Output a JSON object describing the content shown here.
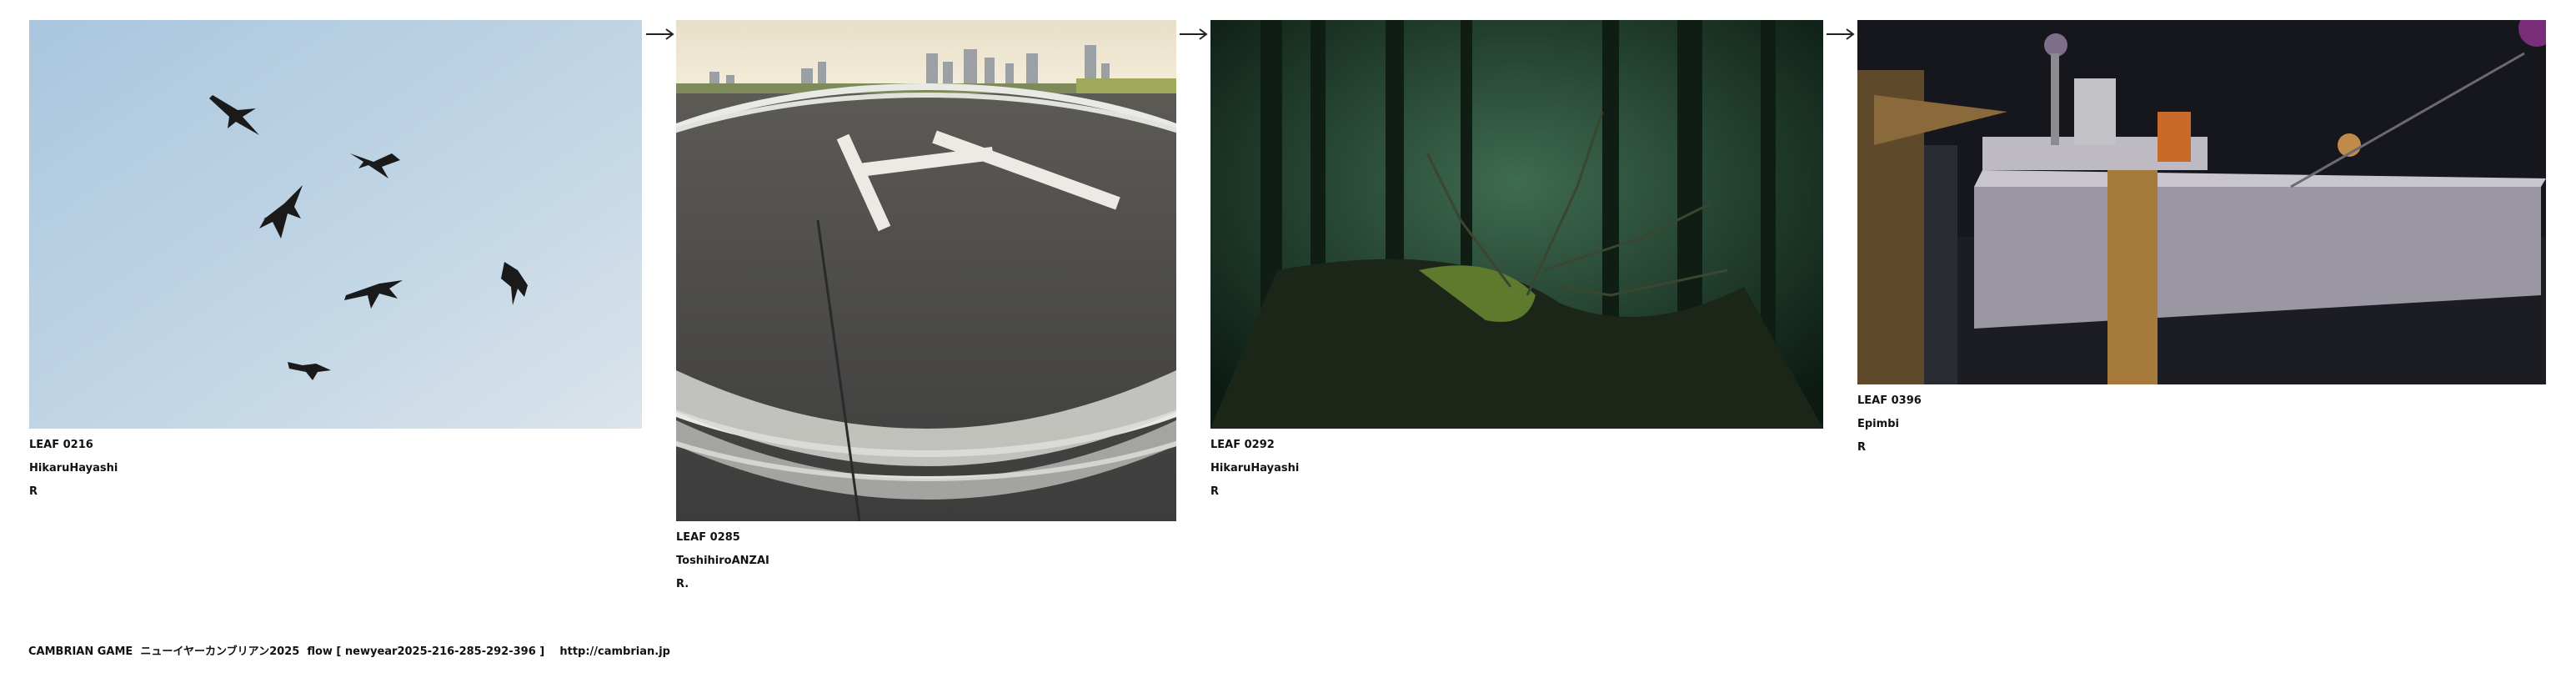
{
  "leaves": [
    {
      "id": "LEAF 0216",
      "author": "HikaruHayashi",
      "mark": "R",
      "image": "birds-in-sky"
    },
    {
      "id": "LEAF 0285",
      "author": "ToshihiroANZAI",
      "mark": "R.",
      "image": "helipad-asphalt"
    },
    {
      "id": "LEAF 0292",
      "author": "HikaruHayashi",
      "mark": "R",
      "image": "dark-forest"
    },
    {
      "id": "LEAF 0396",
      "author": "Epimbi",
      "mark": "R",
      "image": "3d-render-scene"
    }
  ],
  "arrow_icon": "right-arrow-icon",
  "footer": {
    "site": "CAMBRIAN GAME",
    "title": "ニューイヤーカンブリアン2025",
    "flow": "flow [ newyear2025-216-285-292-396 ]",
    "url": "http://cambrian.jp"
  },
  "colors": {
    "sky": "#b9d1e3",
    "asphalt": "#4a4a4a",
    "forest": "#1f3a2a",
    "render_bg": "#15171c"
  }
}
